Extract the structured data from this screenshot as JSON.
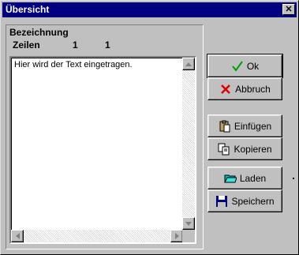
{
  "window": {
    "title": "Übersicht",
    "close_label": "✕"
  },
  "group": {
    "title": "Bezeichnung",
    "zeilen_label": "Zeilen",
    "zeilen_value1": "1",
    "zeilen_value2": "1"
  },
  "textarea": {
    "value": "Hier wird der Text eingetragen."
  },
  "buttons": {
    "ok": "Ok",
    "abbruch": "Abbruch",
    "einfuegen": "Einfügen",
    "kopieren": "Kopieren",
    "laden": "Laden",
    "speichern": "Speichern"
  },
  "colors": {
    "titlebar": "#000080",
    "ok_check": "#00a000",
    "cancel_x": "#e00000",
    "folder": "#00c0c0",
    "floppy": "#000080"
  },
  "icons": {
    "ok": "checkmark-icon",
    "abbruch": "x-icon",
    "einfuegen": "paste-icon",
    "kopieren": "copy-icon",
    "laden": "folder-icon",
    "speichern": "floppy-icon"
  }
}
